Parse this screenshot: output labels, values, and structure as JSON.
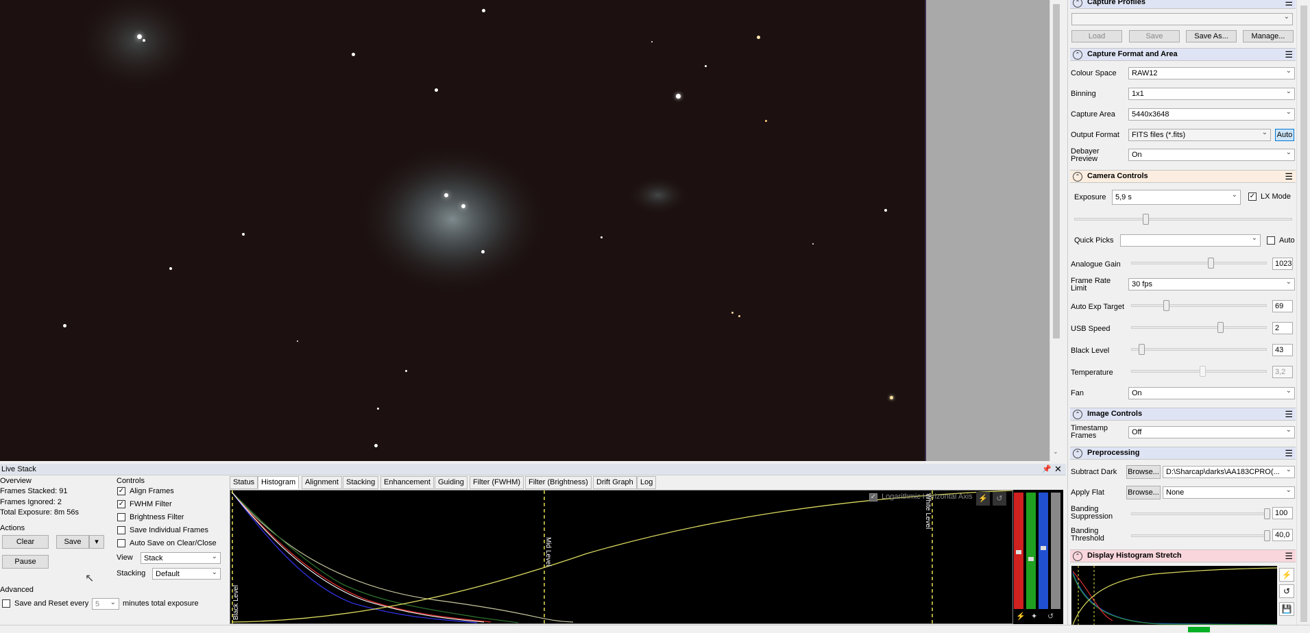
{
  "live_stack": {
    "title": "Live Stack",
    "overview": {
      "heading": "Overview",
      "frames_stacked": "Frames Stacked: 91",
      "frames_ignored": "Frames Ignored:  2",
      "total_exposure": "Total Exposure:   8m 56s"
    },
    "actions": {
      "heading": "Actions",
      "clear": "Clear",
      "save": "Save",
      "pause": "Pause"
    },
    "controls": {
      "heading": "Controls",
      "align": "Align Frames",
      "fwhm": "FWHM Filter",
      "brightness": "Brightness Filter",
      "save_individual": "Save Individual Frames",
      "auto_save": "Auto Save on Clear/Close",
      "view_label": "View",
      "view_value": "Stack",
      "stacking_label": "Stacking",
      "stacking_value": "Default"
    },
    "advanced": {
      "heading": "Advanced",
      "save_reset_label": "Save and Reset every",
      "minutes_value": "5",
      "minutes_suffix": "minutes total exposure"
    },
    "tabs": [
      "Status",
      "Histogram",
      "Alignment",
      "Stacking",
      "Enhancement",
      "Guiding",
      "Filter (FWHM)",
      "Filter (Brightness)",
      "Drift Graph",
      "Log"
    ],
    "histogram": {
      "log_axis_label": "Logarithmic Horizontal Axis",
      "black_level": "Black Level",
      "mid_level": "Mid Level",
      "white_level": "White Level"
    }
  },
  "right_panel": {
    "capture_profiles": {
      "title": "Capture Profiles",
      "load": "Load",
      "save": "Save",
      "save_as": "Save As...",
      "manage": "Manage..."
    },
    "capture_format": {
      "title": "Capture Format and Area",
      "colour_space_label": "Colour Space",
      "colour_space": "RAW12",
      "binning_label": "Binning",
      "binning": "1x1",
      "capture_area_label": "Capture Area",
      "capture_area": "5440x3648",
      "output_format_label": "Output Format",
      "output_format": "FITS files (*.fits)",
      "auto": "Auto",
      "debayer_label": "Debayer Preview",
      "debayer": "On"
    },
    "camera_controls": {
      "title": "Camera Controls",
      "exposure_label": "Exposure",
      "exposure": "5,9 s",
      "lx_mode": "LX Mode",
      "quick_picks_label": "Quick Picks",
      "quick_auto": "Auto",
      "analogue_gain_label": "Analogue Gain",
      "analogue_gain": "1023",
      "frame_rate_label": "Frame Rate Limit",
      "frame_rate": "30 fps",
      "auto_exp_label": "Auto Exp Target",
      "auto_exp": "69",
      "usb_speed_label": "USB Speed",
      "usb_speed": "2",
      "black_level_label": "Black Level",
      "black_level": "43",
      "temperature_label": "Temperature",
      "temperature": "3,2",
      "fan_label": "Fan",
      "fan": "On"
    },
    "image_controls": {
      "title": "Image Controls",
      "timestamp_label": "Timestamp Frames",
      "timestamp": "Off"
    },
    "preprocessing": {
      "title": "Preprocessing",
      "subtract_dark_label": "Subtract Dark",
      "browse": "Browse...",
      "dark_path": "D:\\Sharcap\\darks\\AA183CPRO(...",
      "apply_flat_label": "Apply Flat",
      "flat_value": "None",
      "banding_suppression_label": "Banding Suppression",
      "banding_suppression": "100",
      "banding_threshold_label": "Banding Threshold",
      "banding_threshold": "40,0"
    },
    "display_stretch": {
      "title": "Display Histogram Stretch"
    }
  },
  "colors": {
    "viewer_bg": "#1c1110",
    "section_cam": "#fbeee0",
    "section_stretch": "#f9d6dc",
    "section_pre": "#dfe4f5"
  }
}
